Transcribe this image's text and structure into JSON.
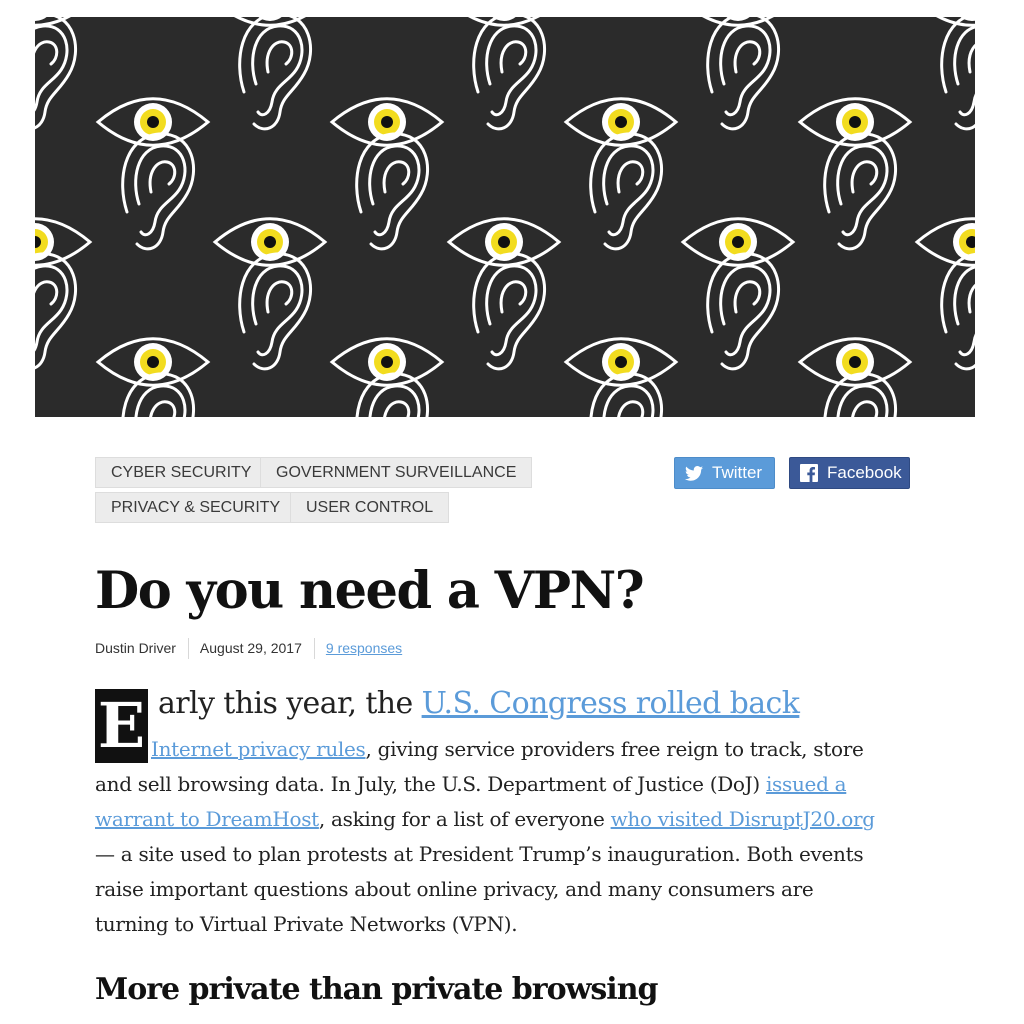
{
  "hero": {
    "image": "eyes-and-ears-pattern"
  },
  "tags": [
    "CYBER SECURITY",
    "GOVERNMENT SURVEILLANCE",
    "PRIVACY & SECURITY",
    "USER CONTROL"
  ],
  "share": {
    "twitter": {
      "label": "Twitter",
      "icon": "twitter-bird-icon"
    },
    "facebook": {
      "label": "Facebook",
      "icon": "facebook-f-icon"
    }
  },
  "article": {
    "title": "Do you need a VPN?",
    "author": "Dustin Driver",
    "date": "August 29, 2017",
    "responses": "9 responses",
    "dropcap": "E",
    "p1": {
      "lead_text": "arly this year, the ",
      "link1_a": "U.S. Congress rolled back",
      "link1_b": "Internet privacy rules",
      "t2": ", giving service providers free reign to track, store",
      "t3": "and sell browsing data. In July, the U.S. Department of Justice (DoJ) ",
      "link2_a": "issued a",
      "link2_b": "warrant to DreamHost",
      "t4": ", asking for a list of everyone ",
      "link3": "who visited DisruptJ20.org",
      "t5": "— a site used to plan protests at President Trump’s inauguration. Both events",
      "t6": "raise important questions about online privacy, and many consumers are",
      "t7": "turning to Virtual Private Networks (VPN)."
    },
    "subhead": "More private than private browsing"
  },
  "colors": {
    "hero_bg": "#2b2b2b",
    "iris": "#f2dc1f",
    "link": "#5b9bd9",
    "twitter": "#5b9bd9",
    "facebook": "#3b5998",
    "tag_bg": "#ececec"
  }
}
